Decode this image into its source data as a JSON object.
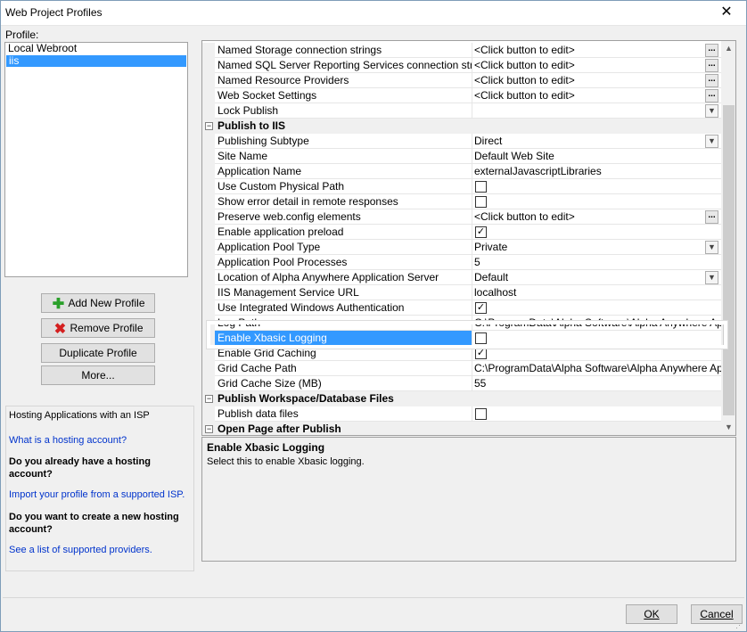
{
  "window": {
    "title": "Web Project Profiles",
    "close_glyph": "✕"
  },
  "profiles": {
    "label": "Profile:",
    "items": [
      "Local Webroot",
      "iis"
    ],
    "selected": "iis"
  },
  "buttons": {
    "add": "Add New Profile",
    "remove": "Remove Profile",
    "duplicate": "Duplicate Profile",
    "more": "More..."
  },
  "hosting": {
    "title": "Hosting Applications with an ISP",
    "link1": "What is a hosting account?",
    "q1": "Do you already have a hosting account?",
    "link2": "Import your profile from a supported ISP.",
    "q2": "Do you want to create a new hosting account?",
    "link3": "See a list of supported providers."
  },
  "grid": {
    "rows": [
      {
        "kind": "prop",
        "name": "Named Storage connection strings",
        "value": "<Click button to edit>",
        "control": "ellipsis"
      },
      {
        "kind": "prop",
        "name": "Named SQL Server Reporting Services connection strings",
        "value": "<Click button to edit>",
        "control": "ellipsis"
      },
      {
        "kind": "prop",
        "name": "Named Resource Providers",
        "value": "<Click button to edit>",
        "control": "ellipsis"
      },
      {
        "kind": "prop",
        "name": "Web Socket Settings",
        "value": "<Click button to edit>",
        "control": "ellipsis"
      },
      {
        "kind": "prop",
        "name": "Lock Publish",
        "value": "",
        "control": "dropdown"
      },
      {
        "kind": "cat",
        "name": "Publish to IIS",
        "toggle": "−"
      },
      {
        "kind": "prop",
        "name": "Publishing Subtype",
        "value": "Direct",
        "control": "dropdown"
      },
      {
        "kind": "prop",
        "name": "Site Name",
        "value": "Default Web Site",
        "control": ""
      },
      {
        "kind": "prop",
        "name": "Application Name",
        "value": "externalJavascriptLibraries",
        "control": ""
      },
      {
        "kind": "prop",
        "name": "Use Custom Physical Path",
        "value": "",
        "control": "checkbox",
        "checked": false
      },
      {
        "kind": "prop",
        "name": "Show error detail in remote responses",
        "value": "",
        "control": "checkbox",
        "checked": false
      },
      {
        "kind": "prop",
        "name": "Preserve web.config elements",
        "value": "<Click button to edit>",
        "control": "ellipsis"
      },
      {
        "kind": "prop",
        "name": "Enable application preload",
        "value": "",
        "control": "checkbox",
        "checked": true
      },
      {
        "kind": "prop",
        "name": "Application Pool Type",
        "value": "Private",
        "control": "dropdown"
      },
      {
        "kind": "prop",
        "name": "Application Pool Processes",
        "value": "5",
        "control": ""
      },
      {
        "kind": "prop",
        "name": "Location of Alpha Anywhere Application Server",
        "value": "Default",
        "control": "dropdown"
      },
      {
        "kind": "prop",
        "name": "IIS Management Service URL",
        "value": "localhost",
        "control": ""
      },
      {
        "kind": "prop",
        "name": "Use Integrated Windows Authentication",
        "value": "",
        "control": "checkbox",
        "checked": true
      },
      {
        "kind": "prop",
        "name": "Log Path",
        "value": "C:\\ProgramData\\Alpha Software\\Alpha Anywhere Applicat",
        "control": ""
      },
      {
        "kind": "prop",
        "name": "Enable Xbasic Logging",
        "value": "",
        "control": "checkbox",
        "checked": false,
        "selected": true
      },
      {
        "kind": "prop",
        "name": "Enable Grid Caching",
        "value": "",
        "control": "checkbox",
        "checked": true
      },
      {
        "kind": "prop",
        "name": "Grid Cache Path",
        "value": "C:\\ProgramData\\Alpha Software\\Alpha Anywhere Applicat",
        "control": ""
      },
      {
        "kind": "prop",
        "name": "Grid Cache Size (MB)",
        "value": "55",
        "control": ""
      },
      {
        "kind": "cat",
        "name": "Publish Workspace/Database Files",
        "toggle": "−"
      },
      {
        "kind": "prop",
        "name": "Publish data files",
        "value": "",
        "control": "checkbox",
        "checked": false
      },
      {
        "kind": "cat",
        "name": "Open Page after Publish",
        "toggle": "−"
      }
    ]
  },
  "description": {
    "title": "Enable Xbasic Logging",
    "text": "Select this to enable Xbasic logging."
  },
  "dialog": {
    "ok": "OK",
    "cancel": "Cancel"
  }
}
